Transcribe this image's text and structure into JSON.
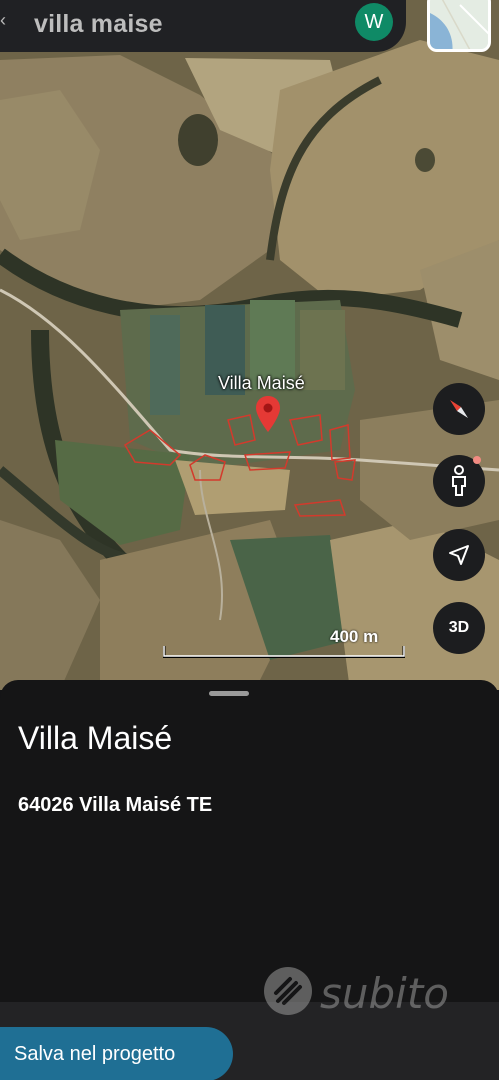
{
  "search": {
    "query": "villa maise"
  },
  "account": {
    "avatar_letter": "W"
  },
  "map": {
    "place_label": "Villa Maisé",
    "scale_label": "400 m",
    "controls": {
      "three_d_label": "3D"
    }
  },
  "place": {
    "name": "Villa Maisé",
    "address": "64026 Villa Maisé TE"
  },
  "actions": {
    "save_label": "Salva nel progetto"
  },
  "watermark": {
    "text": "subito"
  },
  "colors": {
    "pin": "#e53935",
    "boundary": "#d33a2c",
    "save_button": "#1f6f94",
    "avatar": "#0f8a66",
    "sheet_background": "#151516"
  },
  "icons": {
    "back": "back-arrow-icon",
    "compass": "compass-icon",
    "pegman": "pegman-icon",
    "locate": "my-location-icon",
    "pin": "map-pin-icon",
    "layers": "layers-thumbnail"
  }
}
